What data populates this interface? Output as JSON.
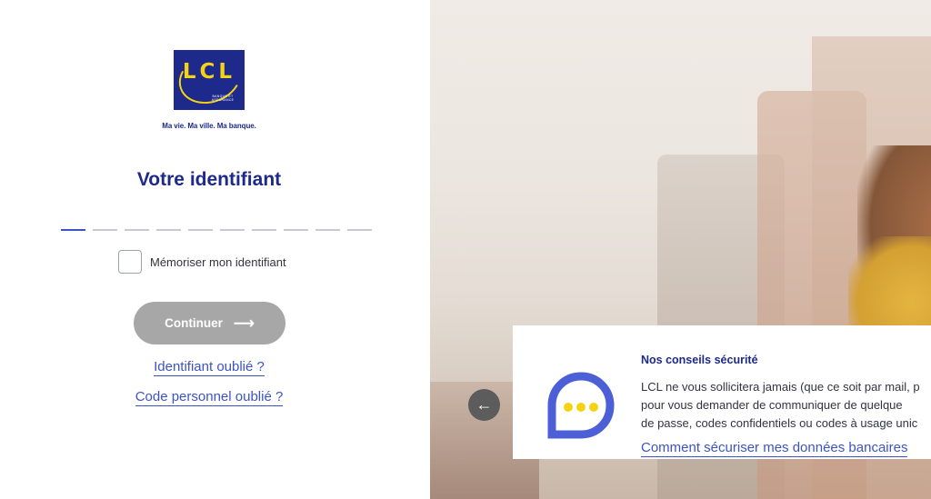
{
  "logo": {
    "letters": "LCL",
    "subtitle": "BANQUE ET ASSURANCE",
    "slogan": "Ma vie. Ma ville. Ma banque."
  },
  "form": {
    "title": "Votre identifiant",
    "digit_count": 10,
    "remember_label": "Mémoriser mon identifiant",
    "remember_checked": false,
    "continue_label": "Continuer",
    "forgot_id_link": "Identifiant oublié ?",
    "forgot_code_link": "Code personnel oublié ?"
  },
  "carousel": {
    "prev_icon": "arrow-left-icon"
  },
  "security_card": {
    "title": "Nos conseils sécurité",
    "text_lines": [
      "LCL ne vous sollicitera jamais (que ce soit par mail, p",
      "pour vous demander de communiquer de quelque",
      "de passe, codes confidentiels ou codes à usage unic"
    ],
    "link": "Comment sécuriser mes données bancaires",
    "icon": "chat-bubble-icon"
  },
  "colors": {
    "brand_blue": "#1d2a8c",
    "link_blue": "#3c53c6",
    "logo_yellow": "#f5d312",
    "button_disabled": "#a7a7a7"
  }
}
